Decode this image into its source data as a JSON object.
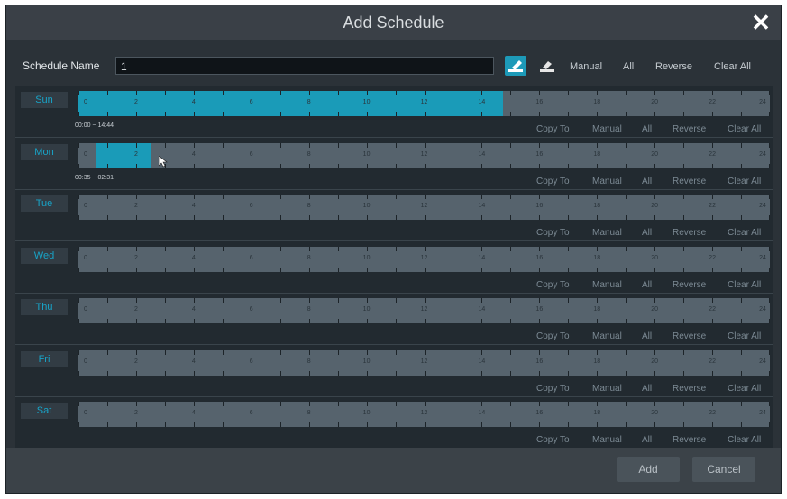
{
  "dialog": {
    "title": "Add Schedule",
    "close_icon": "close-icon"
  },
  "toolbar": {
    "schedule_name_label": "Schedule Name",
    "schedule_name_value": "1",
    "draw_mode_icon": "pencil-draw-icon",
    "erase_mode_icon": "eraser-icon",
    "manual": "Manual",
    "all": "All",
    "reverse": "Reverse",
    "clear_all": "Clear All"
  },
  "hours": [
    "0",
    "2",
    "4",
    "6",
    "8",
    "10",
    "12",
    "14",
    "16",
    "18",
    "20",
    "22",
    "24"
  ],
  "row_actions": {
    "copy_to": "Copy To",
    "manual": "Manual",
    "all": "All",
    "reverse": "Reverse",
    "clear_all": "Clear All"
  },
  "days": [
    {
      "label": "Sun",
      "range_text": "00:00 ~ 14:44",
      "start_hours": 0,
      "end_hours": 14.73
    },
    {
      "label": "Mon",
      "range_text": "00:35 ~ 02:31",
      "start_hours": 0.58,
      "end_hours": 2.52
    },
    {
      "label": "Tue",
      "range_text": "",
      "start_hours": null,
      "end_hours": null
    },
    {
      "label": "Wed",
      "range_text": "",
      "start_hours": null,
      "end_hours": null
    },
    {
      "label": "Thu",
      "range_text": "",
      "start_hours": null,
      "end_hours": null
    },
    {
      "label": "Fri",
      "range_text": "",
      "start_hours": null,
      "end_hours": null
    },
    {
      "label": "Sat",
      "range_text": "",
      "start_hours": null,
      "end_hours": null
    }
  ],
  "footer": {
    "add": "Add",
    "cancel": "Cancel"
  },
  "colors": {
    "accent": "#1a9bb8",
    "label_text": "#18a4c8"
  }
}
